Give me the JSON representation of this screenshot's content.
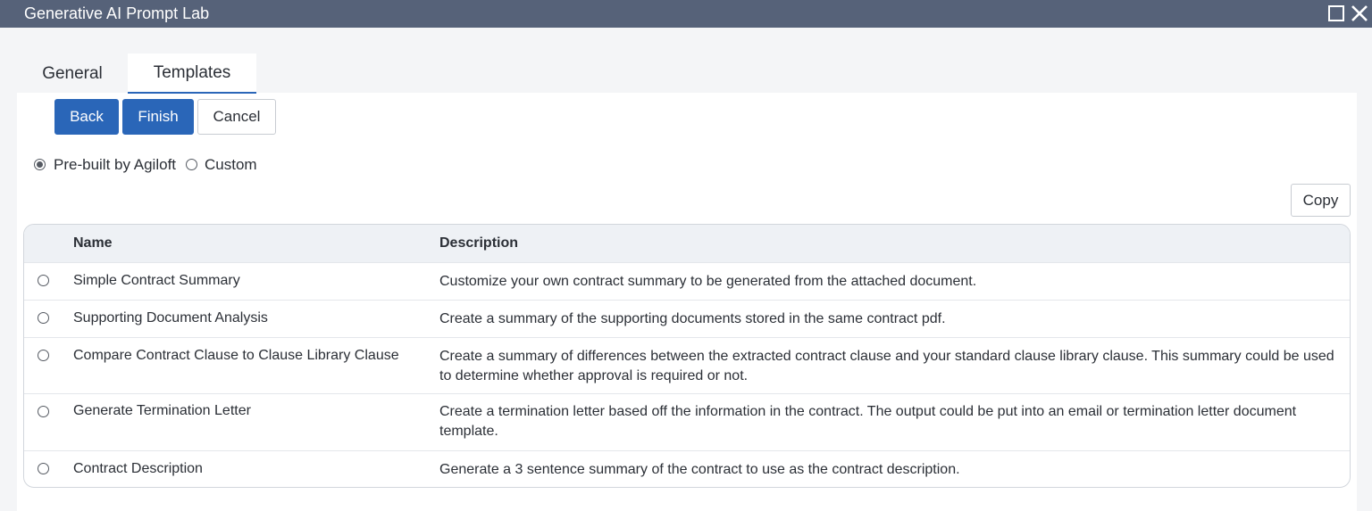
{
  "window": {
    "title": "Generative AI Prompt Lab"
  },
  "tabs": [
    {
      "label": "General"
    },
    {
      "label": "Templates"
    }
  ],
  "actions": {
    "back": "Back",
    "finish": "Finish",
    "cancel": "Cancel",
    "copy": "Copy"
  },
  "source_options": [
    {
      "label": "Pre-built by Agiloft",
      "selected": true
    },
    {
      "label": "Custom",
      "selected": false
    }
  ],
  "table": {
    "columns": {
      "name": "Name",
      "description": "Description"
    },
    "rows": [
      {
        "name": "Simple Contract Summary",
        "description": "Customize your own contract summary to be generated from the attached document."
      },
      {
        "name": "Supporting Document Analysis",
        "description": "Create a summary of the supporting documents stored in the same contract pdf."
      },
      {
        "name": "Compare Contract Clause to Clause Library Clause",
        "description": "Create a summary of differences between the extracted contract clause and your standard clause library clause. This summary could be used to determine whether approval is required or not."
      },
      {
        "name": "Generate Termination Letter",
        "description": "Create a termination letter based off the information in the contract. The output could be put into an email or termination letter document template."
      },
      {
        "name": "Contract Description",
        "description": "Generate a 3 sentence summary of the contract to use as the contract description."
      }
    ]
  },
  "colors": {
    "titlebar": "#566279",
    "primary": "#2a66b8",
    "header_bg": "#eef1f5"
  }
}
